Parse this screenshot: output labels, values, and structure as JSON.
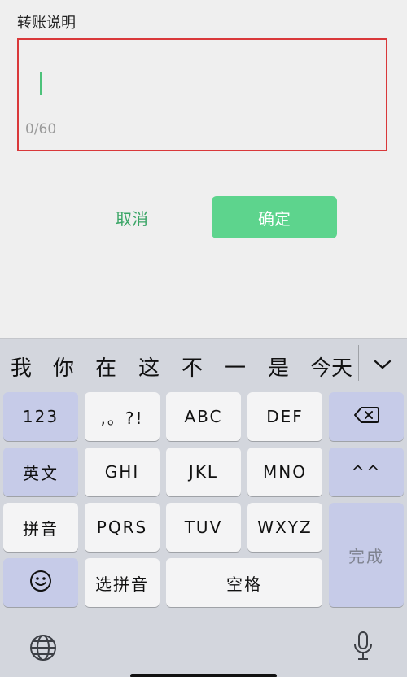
{
  "form": {
    "label": "转账说明",
    "memo_counter": "0/60"
  },
  "actions": {
    "cancel_label": "取消",
    "confirm_label": "确定"
  },
  "keyboard": {
    "candidates": [
      "我",
      "你",
      "在",
      "这",
      "不",
      "一",
      "是",
      "今天"
    ],
    "keys": {
      "num": "123",
      "punct": ",。?!",
      "abc": "ABC",
      "def": "DEF",
      "english": "英文",
      "ghi": "GHI",
      "jkl": "JKL",
      "mno": "MNO",
      "face": "^^",
      "pinyin": "拼音",
      "pqrs": "PQRS",
      "tuv": "TUV",
      "wxyz": "WXYZ",
      "done": "完成",
      "select_pinyin": "选拼音",
      "space": "空格"
    },
    "icons": [
      "chevron-down-icon",
      "backspace-icon",
      "emoji-icon",
      "globe-icon",
      "microphone-icon"
    ]
  },
  "colors": {
    "accent_green": "#5dd48d",
    "cancel_text": "#3aa566",
    "highlight_red": "#d9383a",
    "func_key": "#c6cbe8"
  }
}
